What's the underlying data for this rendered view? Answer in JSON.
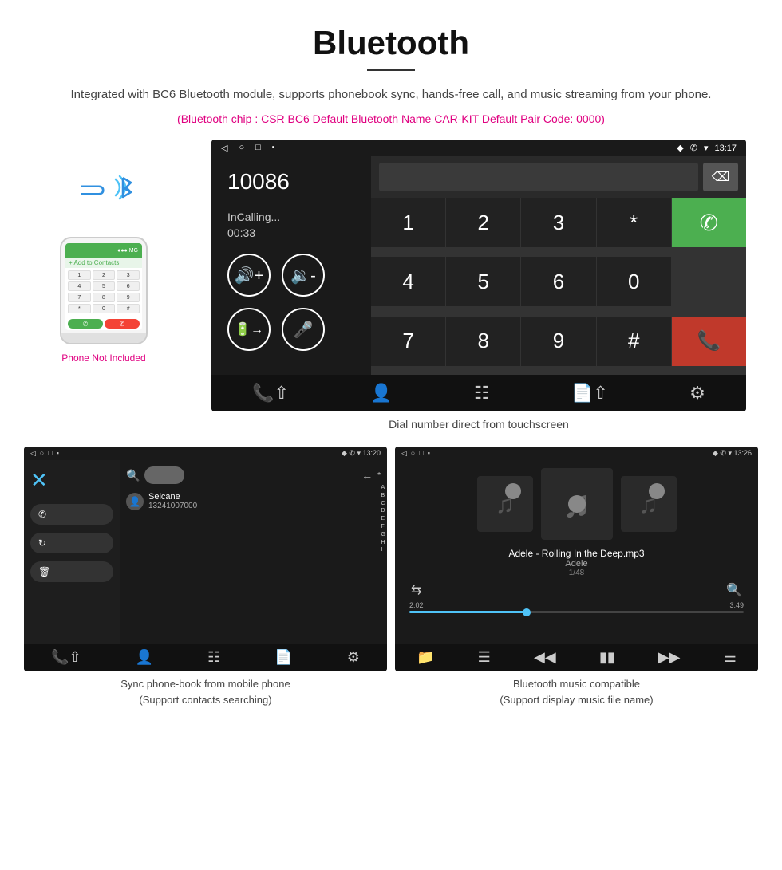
{
  "header": {
    "title": "Bluetooth",
    "description": "Integrated with BC6 Bluetooth module, supports phonebook sync, hands-free call, and music streaming from your phone.",
    "specs": "(Bluetooth chip : CSR BC6    Default Bluetooth Name CAR-KIT    Default Pair Code: 0000)"
  },
  "phone_side": {
    "not_included": "Phone Not Included"
  },
  "car_screen": {
    "status_bar": {
      "nav_icons": [
        "◁",
        "○",
        "□",
        "▪"
      ],
      "right_icons": "♦ ✆ ▾ 13:17"
    },
    "number": "10086",
    "call_status": "InCalling...",
    "call_timer": "00:33",
    "dialpad": [
      "1",
      "2",
      "3",
      "*",
      "4",
      "5",
      "6",
      "0",
      "7",
      "8",
      "9",
      "#"
    ],
    "caption": "Dial number direct from touchscreen"
  },
  "phonebook_screen": {
    "status_bar": {
      "left": "◁  ○  □  ▪",
      "right": "♦ ✆ ▾ 13:20"
    },
    "contact": {
      "name": "Seicane",
      "number": "13241007000"
    },
    "alphabet": [
      "A",
      "B",
      "C",
      "D",
      "E",
      "F",
      "G",
      "H",
      "I"
    ],
    "caption": "Sync phone-book from mobile phone\n(Support contacts searching)"
  },
  "music_screen": {
    "status_bar": {
      "left": "◁  ○  □  ▪",
      "right": "♦ ✆ ▾ 13:26"
    },
    "song_title": "Adele - Rolling In the Deep.mp3",
    "artist": "Adele",
    "track": "1/48",
    "time_current": "2:02",
    "time_total": "3:49",
    "caption": "Bluetooth music compatible\n(Support display music file name)"
  }
}
